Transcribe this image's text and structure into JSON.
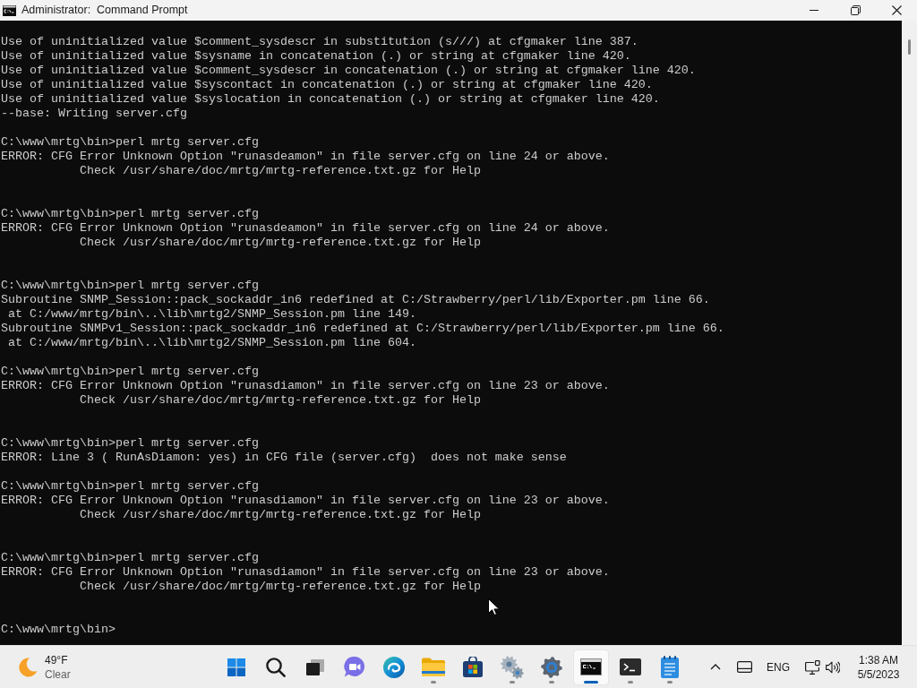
{
  "window": {
    "title": "Administrator:  Command Prompt"
  },
  "console": {
    "lines": [
      {
        "kind": "text",
        "text": "Use of uninitialized value $comment_sysdescr in substitution (s///) at cfgmaker line 387."
      },
      {
        "kind": "text",
        "text": "Use of uninitialized value $sysname in concatenation (.) or string at cfgmaker line 420."
      },
      {
        "kind": "text",
        "text": "Use of uninitialized value $comment_sysdescr in concatenation (.) or string at cfgmaker line 420."
      },
      {
        "kind": "text",
        "text": "Use of uninitialized value $syscontact in concatenation (.) or string at cfgmaker line 420."
      },
      {
        "kind": "text",
        "text": "Use of uninitialized value $syslocation in concatenation (.) or string at cfgmaker line 420."
      },
      {
        "kind": "text",
        "text": "--base: Writing server.cfg"
      },
      {
        "kind": "blank"
      },
      {
        "kind": "text",
        "text": "C:\\www\\mrtg\\bin>perl mrtg server.cfg"
      },
      {
        "kind": "text",
        "text": "ERROR: CFG Error Unknown Option \"runasdeamon\" in file server.cfg on line 24 or above."
      },
      {
        "kind": "text",
        "text": "           Check /usr/share/doc/mrtg/mrtg-reference.txt.gz for Help"
      },
      {
        "kind": "blank"
      },
      {
        "kind": "blank"
      },
      {
        "kind": "text",
        "text": "C:\\www\\mrtg\\bin>perl mrtg server.cfg"
      },
      {
        "kind": "text",
        "text": "ERROR: CFG Error Unknown Option \"runasdeamon\" in file server.cfg on line 24 or above."
      },
      {
        "kind": "text",
        "text": "           Check /usr/share/doc/mrtg/mrtg-reference.txt.gz for Help"
      },
      {
        "kind": "blank"
      },
      {
        "kind": "blank"
      },
      {
        "kind": "text",
        "text": "C:\\www\\mrtg\\bin>perl mrtg server.cfg"
      },
      {
        "kind": "text",
        "text": "Subroutine SNMP_Session::pack_sockaddr_in6 redefined at C:/Strawberry/perl/lib/Exporter.pm line 66."
      },
      {
        "kind": "text",
        "text": " at C:/www/mrtg/bin\\..\\lib\\mrtg2/SNMP_Session.pm line 149."
      },
      {
        "kind": "text",
        "text": "Subroutine SNMPv1_Session::pack_sockaddr_in6 redefined at C:/Strawberry/perl/lib/Exporter.pm line 66."
      },
      {
        "kind": "text",
        "text": " at C:/www/mrtg/bin\\..\\lib\\mrtg2/SNMP_Session.pm line 604."
      },
      {
        "kind": "blank"
      },
      {
        "kind": "text",
        "text": "C:\\www\\mrtg\\bin>perl mrtg server.cfg"
      },
      {
        "kind": "text",
        "text": "ERROR: CFG Error Unknown Option \"runasdiamon\" in file server.cfg on line 23 or above."
      },
      {
        "kind": "text",
        "text": "           Check /usr/share/doc/mrtg/mrtg-reference.txt.gz for Help"
      },
      {
        "kind": "blank"
      },
      {
        "kind": "blank"
      },
      {
        "kind": "text",
        "text": "C:\\www\\mrtg\\bin>perl mrtg server.cfg"
      },
      {
        "kind": "text",
        "text": "ERROR: Line 3 ( RunAsDiamon: yes) in CFG file (server.cfg)  does not make sense"
      },
      {
        "kind": "blank"
      },
      {
        "kind": "text",
        "text": "C:\\www\\mrtg\\bin>perl mrtg server.cfg"
      },
      {
        "kind": "text",
        "text": "ERROR: CFG Error Unknown Option \"runasdiamon\" in file server.cfg on line 23 or above."
      },
      {
        "kind": "text",
        "text": "           Check /usr/share/doc/mrtg/mrtg-reference.txt.gz for Help"
      },
      {
        "kind": "blank"
      },
      {
        "kind": "blank"
      },
      {
        "kind": "text",
        "text": "C:\\www\\mrtg\\bin>perl mrtg server.cfg"
      },
      {
        "kind": "text",
        "text": "ERROR: CFG Error Unknown Option \"runasdiamon\" in file server.cfg on line 23 or above."
      },
      {
        "kind": "text",
        "text": "           Check /usr/share/doc/mrtg/mrtg-reference.txt.gz for Help"
      },
      {
        "kind": "blank"
      },
      {
        "kind": "blank"
      },
      {
        "kind": "text",
        "text": "C:\\www\\mrtg\\bin>"
      }
    ]
  },
  "taskbar": {
    "weather": {
      "temperature": "49°F",
      "condition": "Clear"
    },
    "apps": [
      {
        "kind": "start",
        "running": false,
        "selected": false
      },
      {
        "kind": "search",
        "running": false,
        "selected": false
      },
      {
        "kind": "task-view",
        "running": false,
        "selected": false
      },
      {
        "kind": "chat",
        "running": false,
        "selected": false
      },
      {
        "kind": "browser",
        "running": false,
        "selected": false
      },
      {
        "kind": "folder",
        "running": true,
        "selected": false
      },
      {
        "kind": "store",
        "running": false,
        "selected": false
      },
      {
        "kind": "gears",
        "running": true,
        "selected": false
      },
      {
        "kind": "settings",
        "running": true,
        "selected": false
      },
      {
        "kind": "console",
        "running": true,
        "selected": true
      },
      {
        "kind": "terminal",
        "running": true,
        "selected": false
      },
      {
        "kind": "notepad",
        "running": true,
        "selected": false
      }
    ],
    "tray": {
      "language": "ENG",
      "time": "1:38 AM",
      "date": "5/5/2023"
    }
  }
}
